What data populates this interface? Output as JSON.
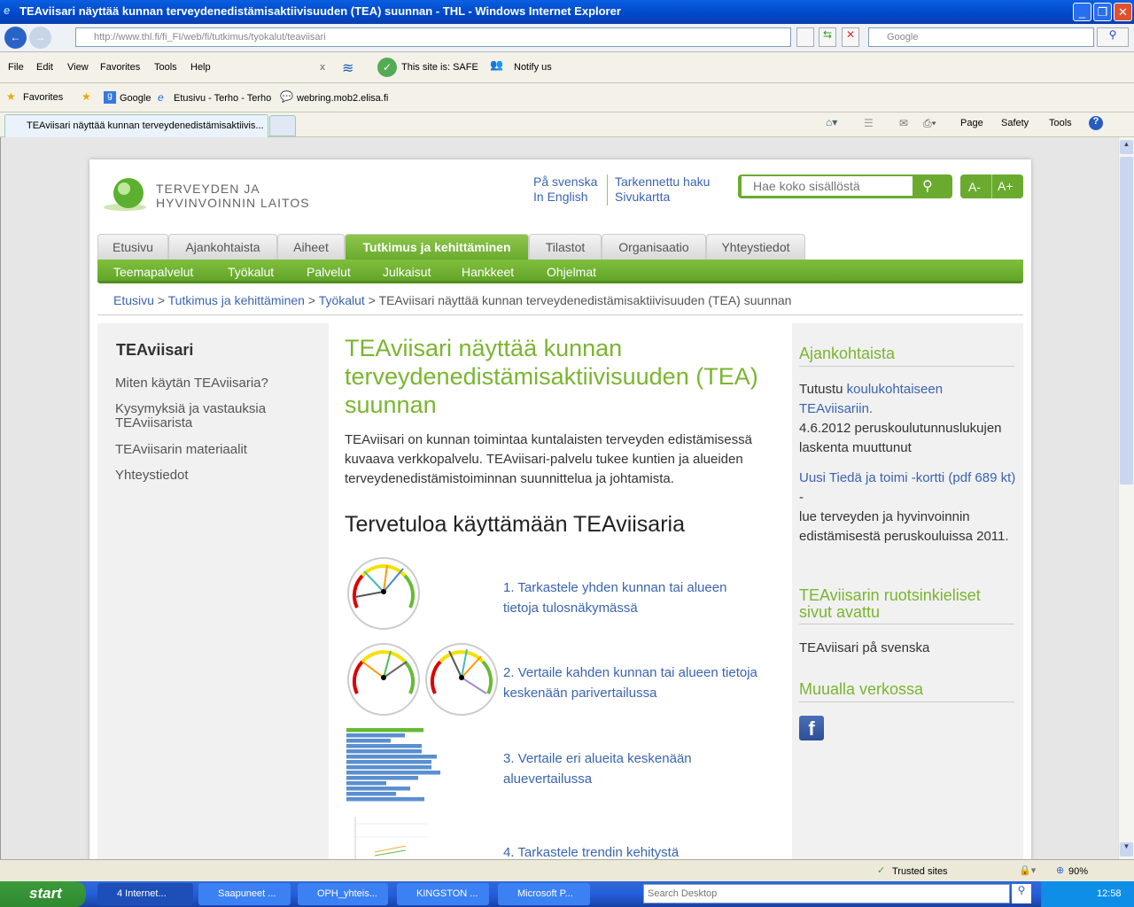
{
  "window": {
    "title": "TEAviisari näyttää kunnan terveydenedistämisaktiivisuuden (TEA) suunnan - THL - Windows Internet Explorer"
  },
  "browser": {
    "url": "http://www.thl.fi/fi_FI/web/fi/tutkimus/tyokalut/teaviisari",
    "search_placeholder": "Google",
    "menu": [
      "File",
      "Edit",
      "View",
      "Favorites",
      "Tools",
      "Help"
    ],
    "toolbar": {
      "safe": "This site is: SAFE",
      "notify": "Notify us",
      "close": "x"
    },
    "favorites": {
      "label": "Favorites",
      "items": [
        "Google",
        "Etusivu - Terho - Terho",
        "webring.mob2.elisa.fi"
      ]
    },
    "tab": "TEAviisari näyttää kunnan terveydenedistämisaktiivis...",
    "cmd": [
      "Page",
      "Safety",
      "Tools"
    ],
    "status": {
      "zone": "Trusted sites",
      "zoom": "90%"
    }
  },
  "site": {
    "logo_line1": "TERVEYDEN JA",
    "logo_line2": "HYVINVOINNIN LAITOS",
    "links": [
      "På svenska",
      "In English",
      "Tarkennettu haku",
      "Sivukartta"
    ],
    "search_placeholder": "Hae koko sisällöstä",
    "font_minus": "A-",
    "font_plus": "A+",
    "nav": [
      "Etusivu",
      "Ajankohtaista",
      "Aiheet",
      "Tutkimus ja kehittäminen",
      "Tilastot",
      "Organisaatio",
      "Yhteystiedot"
    ],
    "subnav": [
      "Teemapalvelut",
      "Työkalut",
      "Palvelut",
      "Julkaisut",
      "Hankkeet",
      "Ohjelmat"
    ],
    "breadcrumb": [
      "Etusivu",
      ">",
      "Tutkimus ja kehittäminen",
      ">",
      "Työkalut",
      ">",
      "TEAviisari näyttää kunnan terveydenedistämisaktiivisuuden (TEA) suunnan"
    ],
    "brand_green": "#6aab2f",
    "link_blue": "#3a64b0"
  },
  "left": {
    "title": "TEAviisari",
    "items": [
      "Miten käytän TEAviisaria?",
      "Kysymyksiä ja vastauksia TEAviisarista",
      "TEAviisarin materiaalit",
      "Yhteystiedot"
    ]
  },
  "main": {
    "title": "TEAviisari näyttää kunnan terveydenedistämisaktiivisuuden (TEA) suunnan",
    "intro": "TEAviisari on kunnan toimintaa kuntalaisten terveyden edistämisessä kuvaava verkkopalvelu. TEAviisari-palvelu tukee kuntien ja alueiden terveydenedistämistoiminnan suunnittelua ja johtamista.",
    "subtitle": "Tervetuloa käyttämään TEAviisaria",
    "steps": [
      "1. Tarkastele yhden kunnan tai alueen tietoja tulosnäkymässä",
      "2. Vertaile kahden kunnan tai alueen tietoja keskenään parivertailussa",
      "3. Vertaile eri alueita keskenään aluevertailussa",
      "4. Tarkastele trendin kehitystä"
    ]
  },
  "right": {
    "h1": "Ajankohtaista",
    "p1_text": "Tutustu ",
    "p1_link": "koulukohtaiseen TEAviisariin.",
    "p1_rest": "4.6.2012 peruskoulutunnuslukujen laskenta muuttunut",
    "p2_link": "Uusi Tiedä ja toimi -kortti (pdf 689 kt)",
    "p2_dash": " -",
    "p2_rest": "lue terveyden ja hyvinvoinnin edistämisestä peruskouluissa 2011.",
    "h2": "TEAviisarin ruotsinkieliset sivut avattu",
    "p3_link": "TEAviisari på svenska",
    "h3": "Muualla verkossa"
  },
  "taskbar": {
    "start": "start",
    "items": [
      "4 Internet...",
      "Saapuneet ...",
      "OPH_yhteis...",
      "KINGSTON ...",
      "Microsoft P..."
    ],
    "search": "Search Desktop",
    "clock": "12:58"
  }
}
